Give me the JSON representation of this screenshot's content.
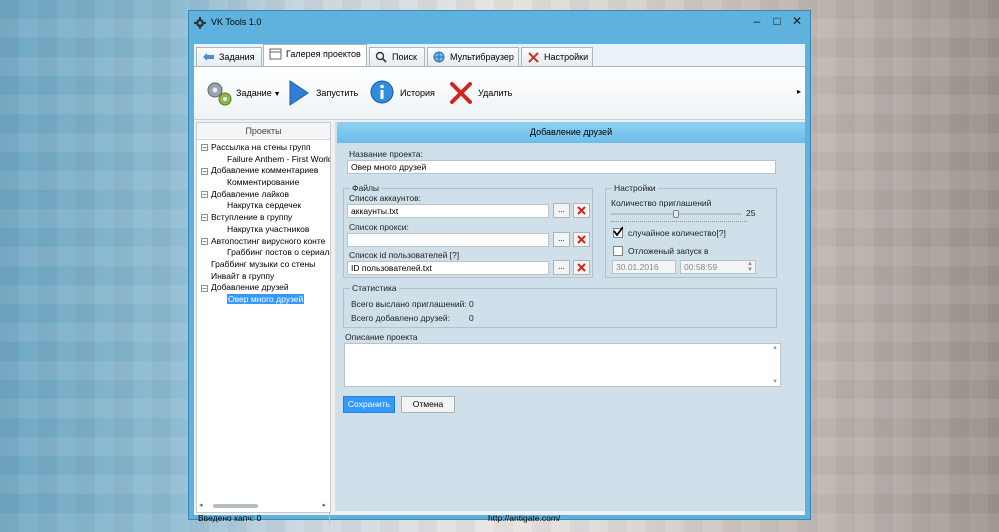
{
  "window": {
    "title": "VK Tools  1.0",
    "min": "–",
    "max": "□",
    "close": "✕"
  },
  "tabs": [
    "Задания",
    "Галерея проектов",
    "Поиск",
    "Мультибраузер",
    "Настройки"
  ],
  "ribbon": {
    "task": "Задание",
    "run": "Запустить",
    "history": "История",
    "delete": "Удалить",
    "more": "▸"
  },
  "left": {
    "header": "Проекты",
    "tree": [
      {
        "label": "Рассылка на стены групп",
        "children": [
          "Failure Anthem - First World P"
        ]
      },
      {
        "label": "Добавление комментариев",
        "children": [
          "Комментирование"
        ]
      },
      {
        "label": "Добавление лайков",
        "children": [
          "Накрутка сердечек"
        ]
      },
      {
        "label": "Вступление в группу",
        "children": [
          "Накрутка участников"
        ]
      },
      {
        "label": "Автопостинг вирусного конте",
        "children": [
          "Граббинг постов о сериала"
        ]
      },
      {
        "label": "Граббинг музыки со стены",
        "children": []
      },
      {
        "label": "Инвайт в группу",
        "children": []
      },
      {
        "label": "Добавление друзей",
        "children": [
          "Овер много друзей"
        ]
      }
    ]
  },
  "form": {
    "header": "Добавление друзей",
    "name_label": "Название проекта:",
    "name_value": "Овер много друзей",
    "files_group": "Файлы",
    "accounts_label": "Список аккаунтов:",
    "accounts_value": "аккаунты.txt",
    "proxy_label": "Список прокси:",
    "proxy_value": "",
    "ids_label": "Список id пользователей [?]",
    "ids_value": "ID пользователей.txt",
    "browse": "...",
    "settings_group": "Настройки",
    "invites_label": "Количество приглашений",
    "invites_value": 25,
    "invites_text": "25",
    "random_label": "случайное количество[?]",
    "random_checked": true,
    "delayed_label": "Отложеный запуск в",
    "delayed_checked": false,
    "date_value": "30.01.2016",
    "time_value": "00:58:59",
    "stats_group": "Статистика",
    "sent_label": "Всего выслано приглашений:",
    "sent_value": "0",
    "added_label": "Всего добавлено друзей:",
    "added_value": "0",
    "desc_label": "Описание проекта",
    "save": "Сохранить",
    "cancel": "Отмена"
  },
  "status": {
    "captcha": "Введено капч: 0",
    "url": "http://antigate.com/"
  }
}
